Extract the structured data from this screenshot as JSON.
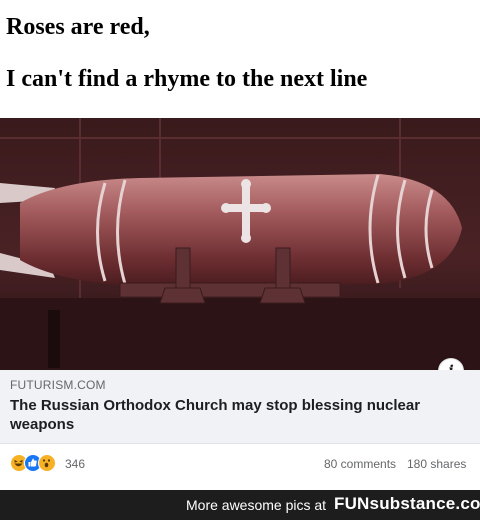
{
  "caption": {
    "line1": "Roses are red,",
    "line2": "I can't find a rhyme to the next line"
  },
  "link_preview": {
    "domain": "FUTURISM.COM",
    "title": "The Russian Orthodox Church may stop blessing nuclear weapons",
    "info_icon": "info-icon"
  },
  "engagement": {
    "reaction_icons": [
      "haha-icon",
      "like-icon",
      "wow-icon"
    ],
    "reaction_count": "346",
    "comments": "80 comments",
    "shares": "180 shares"
  },
  "watermark": {
    "text": "More awesome pics at",
    "logo": "FUNsubstance.com"
  },
  "colors": {
    "photo_tint": "#7a2a2e",
    "like_blue": "#1877f2",
    "reaction_yellow": "#f7b125",
    "preview_bg": "#f0f2f5",
    "watermark_bg": "#1d1d1d"
  }
}
